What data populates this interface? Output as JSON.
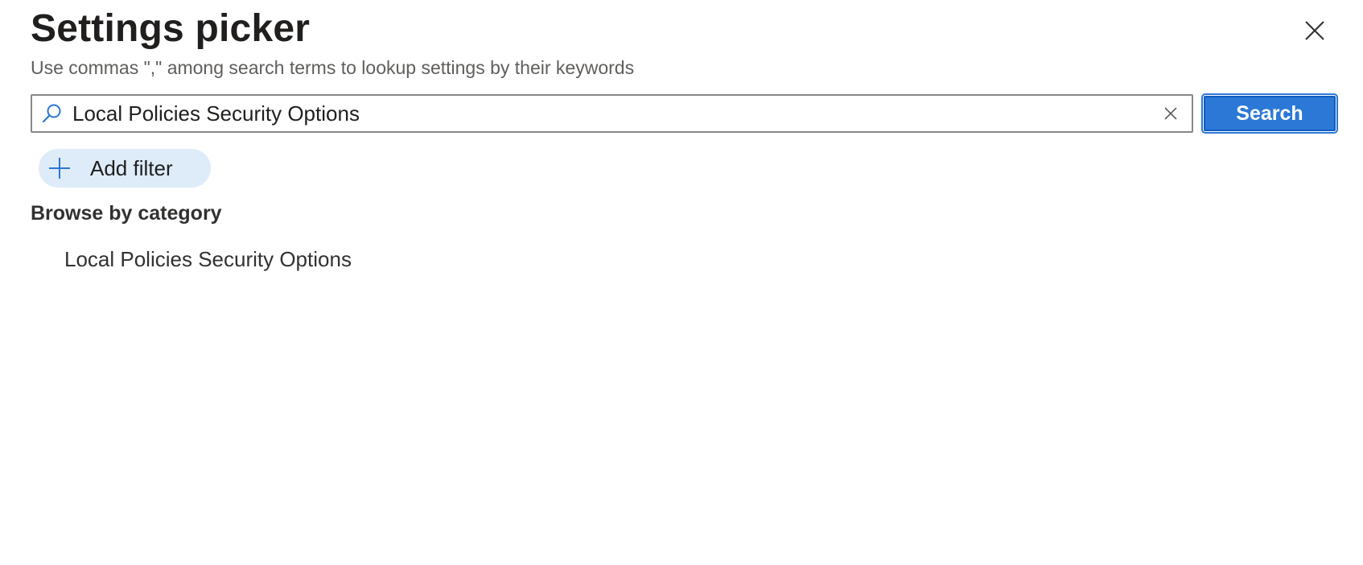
{
  "panel": {
    "title": "Settings picker",
    "subtitle": "Use commas \",\" among search terms to lookup settings by their keywords",
    "close_icon": "close-icon"
  },
  "search": {
    "value": "Local Policies Security Options",
    "search_icon": "search-icon",
    "clear_icon": "clear-icon",
    "button_label": "Search"
  },
  "filter": {
    "add_label": "Add filter",
    "icon": "plus-icon"
  },
  "browse": {
    "heading": "Browse by category",
    "items": [
      {
        "label": "Local Policies Security Options"
      }
    ]
  },
  "colors": {
    "accent": "#2b78d6",
    "filter_bg": "#deecf9",
    "text": "#323130",
    "subtext": "#605e5c"
  }
}
